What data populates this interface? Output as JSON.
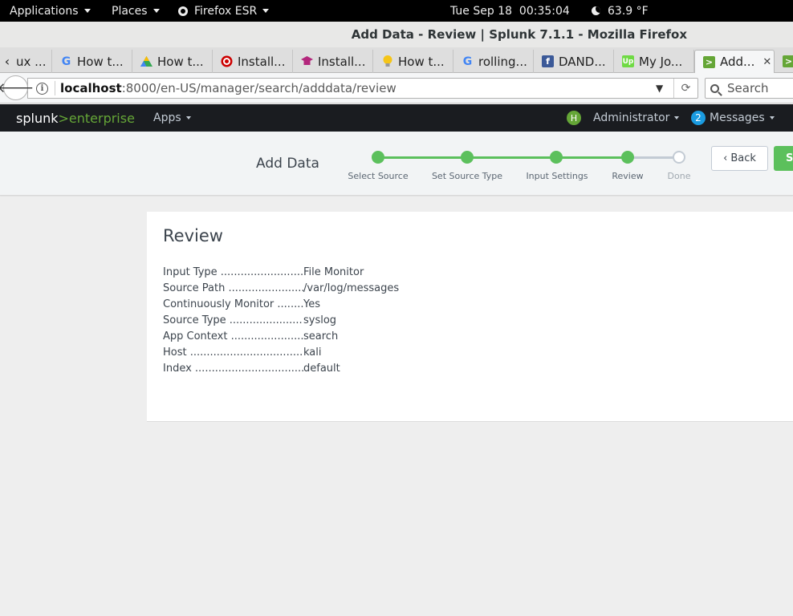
{
  "gnome": {
    "applications": "Applications",
    "places": "Places",
    "firefox": "Firefox ESR",
    "datetime": "Tue Sep 18  00:35:04",
    "weather": "63.9 °F"
  },
  "window": {
    "title": "Add Data - Review | Splunk 7.1.1 - Mozilla Firefox"
  },
  "tabs": [
    {
      "label": "ux ...",
      "icon": "generic-icon"
    },
    {
      "label": "How t...",
      "icon": "google-icon"
    },
    {
      "label": "How t...",
      "icon": "triangle-icon"
    },
    {
      "label": "Install...",
      "icon": "target-icon"
    },
    {
      "label": "Install...",
      "icon": "grad-cap-icon"
    },
    {
      "label": "How t...",
      "icon": "bulb-icon"
    },
    {
      "label": "rolling...",
      "icon": "google-icon"
    },
    {
      "label": "DAND...",
      "icon": "facebook-icon"
    },
    {
      "label": "My Jo...",
      "icon": "upwork-icon"
    },
    {
      "label": "Add...",
      "icon": "splunk-icon"
    }
  ],
  "url": {
    "host": "localhost",
    "rest": ":8000/en-US/manager/search/adddata/review"
  },
  "search": {
    "placeholder": "Search"
  },
  "splunk": {
    "logo_a": "splunk",
    "logo_gt": ">",
    "logo_b": "enterprise",
    "apps": "Apps",
    "avatar_letter": "H",
    "user": "Administrator",
    "message_count": "2",
    "messages": "Messages"
  },
  "wizard": {
    "title": "Add Data",
    "steps": [
      {
        "label": "Select Source",
        "status": "done"
      },
      {
        "label": "Set Source Type",
        "status": "done"
      },
      {
        "label": "Input Settings",
        "status": "done"
      },
      {
        "label": "Review",
        "status": "done"
      },
      {
        "label": "Done",
        "status": "todo"
      }
    ],
    "back": "Back",
    "submit": "Submit"
  },
  "review": {
    "title": "Review",
    "rows": [
      {
        "label": "Input Type ....................................",
        "value": "File Monitor"
      },
      {
        "label": "Source Path ...............................",
        "value": "/var/log/messages"
      },
      {
        "label": "Continuously Monitor ...........",
        "value": "Yes"
      },
      {
        "label": "Source Type ..............................",
        "value": "syslog"
      },
      {
        "label": "App Context ...............................",
        "value": "search"
      },
      {
        "label": "Host .............................................",
        "value": "kali"
      },
      {
        "label": "Index ............................................",
        "value": "default"
      }
    ]
  },
  "colors": {
    "splunk_green": "#65a637",
    "step_done": "#5cc05c",
    "header_bg": "#1a1c20",
    "message_badge": "#1a9be0"
  }
}
